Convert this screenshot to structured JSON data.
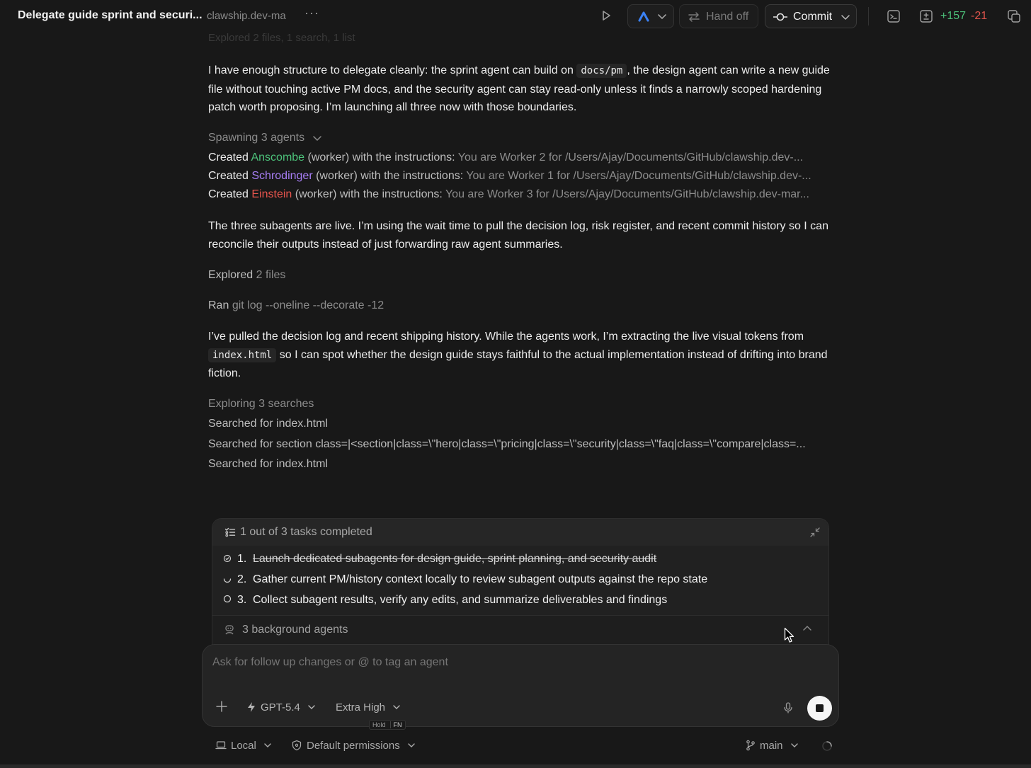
{
  "topbar": {
    "title": "Delegate guide sprint and securi...",
    "subtitle": "clawship.dev-ma",
    "more_label": "···",
    "handoff_label": "Hand off",
    "commit_label": "Commit",
    "diff_added": "+157",
    "diff_removed": "-21"
  },
  "conversation": {
    "faded_line": "Explored 2 files, 1 search, 1 list",
    "para1_a": "I have enough structure to delegate cleanly: the sprint agent can build on ",
    "para1_code": "docs/pm",
    "para1_b": ", the design agent can write a new guide file without touching active PM docs, and the security agent can stay read-only unless it finds a narrowly scoped hardening patch worth proposing. I’m launching all three now with those boundaries.",
    "spawning_label": "Spawning 3 agents",
    "agents": [
      {
        "created": "Created",
        "name": "Anscombe",
        "rest": " (worker) with the instructions: ",
        "instr": "You are Worker 2 for /Users/Ajay/Documents/GitHub/clawship.dev-..."
      },
      {
        "created": "Created",
        "name": "Schrodinger",
        "rest": " (worker) with the instructions: ",
        "instr": "You are Worker 1 for /Users/Ajay/Documents/GitHub/clawship.dev-..."
      },
      {
        "created": "Created",
        "name": "Einstein",
        "rest": " (worker) with the instructions: ",
        "instr": "You are Worker 3 for /Users/Ajay/Documents/GitHub/clawship.dev-mar..."
      }
    ],
    "para2": "The three subagents are live. I’m using the wait time to pull the decision log, risk register, and recent commit history so I can reconcile their outputs instead of just forwarding raw agent summaries.",
    "explored_verb": "Explored",
    "explored_obj": "2 files",
    "ran_verb": "Ran",
    "ran_cmd": "git log --oneline --decorate -12",
    "para3_a": "I’ve pulled the decision log and recent shipping history. While the agents work, I’m extracting the live visual tokens from ",
    "para3_code": "index.html",
    "para3_b": " so I can spot whether the design guide stays faithful to the actual implementation instead of drifting into brand fiction.",
    "exploring_label": "Exploring 3 searches",
    "searches": [
      "Searched for index.html",
      "Searched for section class=|<section|class=\\\"hero|class=\\\"pricing|class=\\\"security|class=\\\"faq|class=\\\"compare|class=...",
      "Searched for index.html"
    ]
  },
  "tasks": {
    "title": "1 out of 3 tasks completed",
    "items": [
      {
        "num": "1.",
        "label": "Launch dedicated subagents for design guide, sprint planning, and security audit"
      },
      {
        "num": "2.",
        "label": "Gather current PM/history context locally to review subagent outputs against the repo state"
      },
      {
        "num": "3.",
        "label": "Collect subagent results, verify any edits, and summarize deliverables and findings"
      }
    ],
    "background_label": "3 background agents"
  },
  "composer": {
    "placeholder": "Ask for follow up changes or @ to tag an agent",
    "model_label": "GPT-5.4",
    "effort_label": "Extra High",
    "hold_label": "Hold",
    "fn_label": "FN"
  },
  "footer": {
    "env_label": "Local",
    "permissions_label": "Default permissions",
    "branch_label": "main"
  },
  "colors": {
    "background": "#181818",
    "agent_green": "#4cc27a",
    "agent_purple": "#a77ef5",
    "agent_red": "#e8554d",
    "accent_blue": "#3b82f6"
  }
}
